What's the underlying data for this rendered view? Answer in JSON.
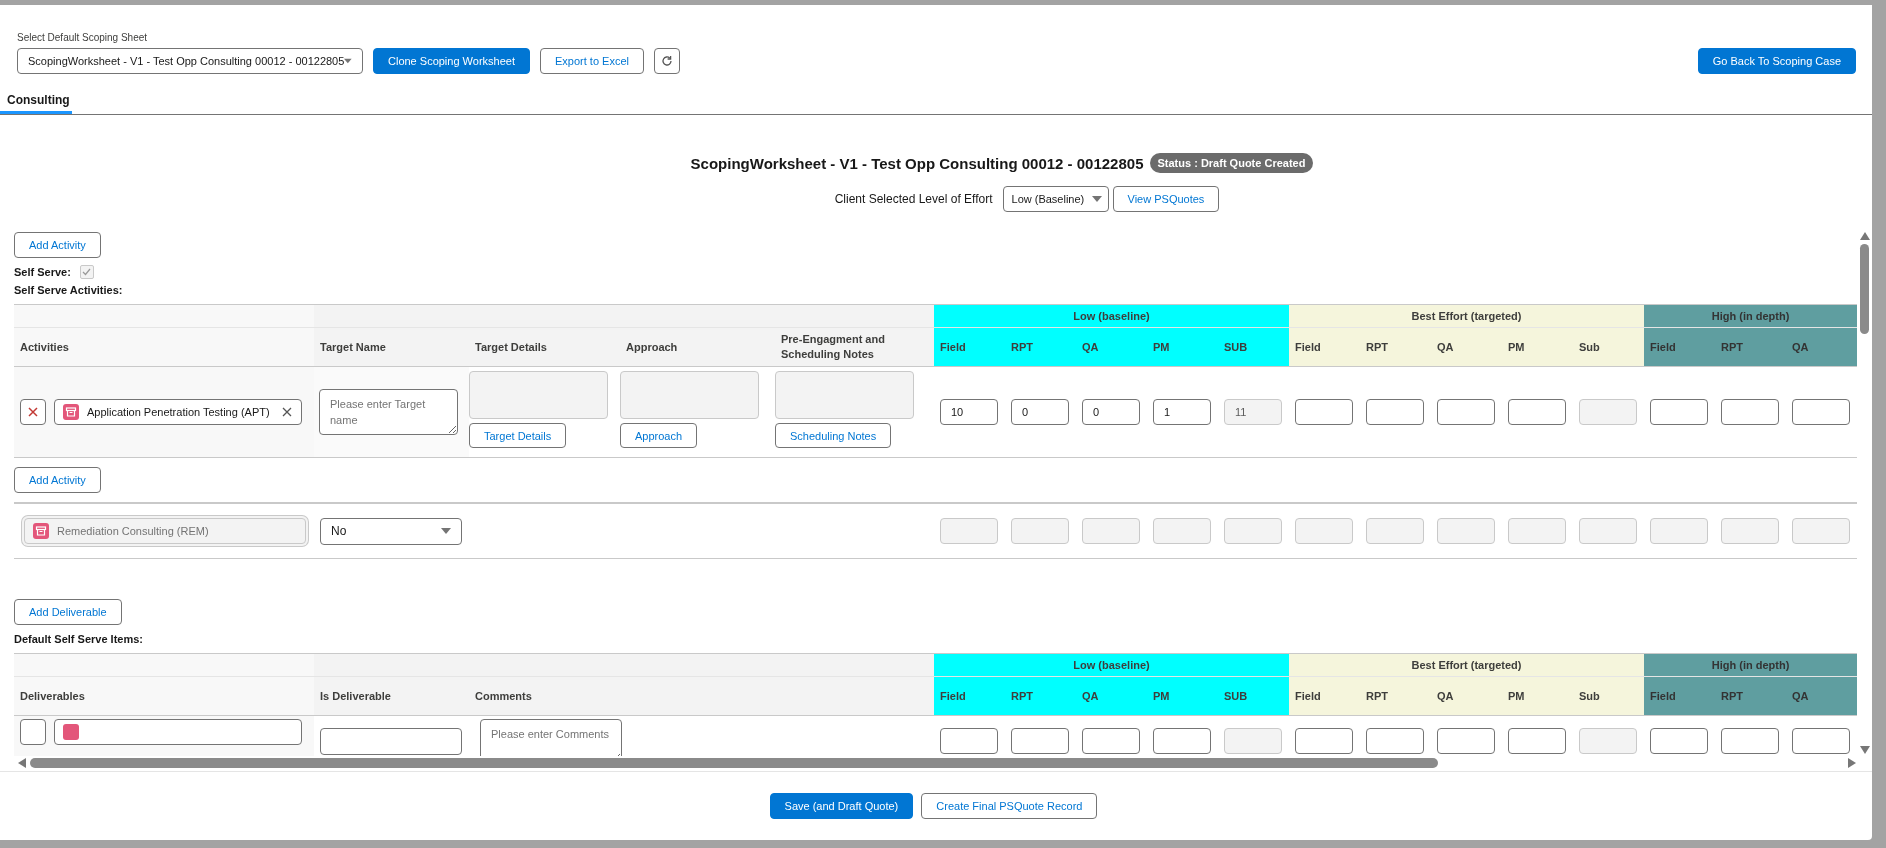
{
  "sheet_select": {
    "label": "Select Default Scoping Sheet",
    "value": "ScopingWorksheet - V1 - Test Opp Consulting 00012 - 00122805"
  },
  "toolbar": [
    {
      "kind": "brand",
      "label": "Clone Scoping Worksheet"
    },
    {
      "kind": "neutral",
      "label": "Export to Excel"
    },
    {
      "kind": "refresh"
    }
  ],
  "back_button": {
    "label": "Go Back To Scoping Case"
  },
  "tabs": [
    {
      "label": "Consulting",
      "selected": true
    }
  ],
  "worksheet": {
    "title": "ScopingWorksheet - V1 - Test Opp Consulting 00012 - 00122805",
    "status": "Status : Draft Quote Created"
  },
  "effort": {
    "label": "Client Selected Level of Effort",
    "value": "Low (Baseline)",
    "button": "View PSQuotes"
  },
  "activities": {
    "add_button": "Add Activity",
    "self_serve": {
      "label": "Self Serve:",
      "checked": true,
      "disabled": true
    },
    "heading": "Self Serve Activities:",
    "columns": [
      "Activities",
      "Target Name",
      "Target Details",
      "Approach",
      "Pre-Engagment and Scheduling Notes"
    ],
    "tiers": [
      {
        "label": "Low (baseline)",
        "color": "#00ffff",
        "columns": [
          "Field",
          "RPT",
          "QA",
          "PM",
          "SUB"
        ]
      },
      {
        "label": "Best Effort (targeted)",
        "color": "#f5f5dc",
        "columns": [
          "Field",
          "RPT",
          "QA",
          "PM",
          "Sub"
        ]
      },
      {
        "label": "High (in depth)",
        "color": "#5f9ea0",
        "columns": [
          "Field",
          "RPT",
          "QA"
        ]
      }
    ],
    "rows": [
      {
        "name": "Application Penetration Testing (APT)",
        "target_name_placeholder": "Please enter Target name",
        "buttons": [
          "Target Details",
          "Approach",
          "Scheduling Notes"
        ],
        "efforts": [
          {
            "value": "10",
            "disabled": false
          },
          {
            "value": "0",
            "disabled": false
          },
          {
            "value": "0",
            "disabled": false
          },
          {
            "value": "1",
            "disabled": false
          },
          {
            "value": "11",
            "disabled": true
          },
          {
            "disabled": false
          },
          {
            "disabled": false
          },
          {
            "disabled": false
          },
          {
            "disabled": false
          },
          {
            "disabled": true
          },
          {
            "disabled": false
          },
          {
            "disabled": false
          },
          {
            "disabled": false
          }
        ]
      }
    ],
    "add_button_bottom": "Add Activity",
    "fixed_rows": [
      {
        "name": "Remediation Consulting (REM)",
        "choice": "No",
        "efforts": [
          {
            "disabled": true
          },
          {
            "disabled": true
          },
          {
            "disabled": true
          },
          {
            "disabled": true
          },
          {
            "disabled": true
          },
          {
            "disabled": true
          },
          {
            "disabled": true
          },
          {
            "disabled": true
          },
          {
            "disabled": true
          },
          {
            "disabled": true
          },
          {
            "disabled": true
          },
          {
            "disabled": true
          },
          {
            "disabled": true
          }
        ]
      }
    ]
  },
  "deliverables": {
    "add_button": "Add Deliverable",
    "heading": "Default Self Serve Items:",
    "columns": [
      "Deliverables",
      "Is Deliverable",
      "Comments"
    ],
    "tiers": [
      {
        "label": "Low (baseline)",
        "color": "#00ffff",
        "columns": [
          "Field",
          "RPT",
          "QA",
          "PM",
          "SUB"
        ]
      },
      {
        "label": "Best Effort (targeted)",
        "color": "#f5f5dc",
        "columns": [
          "Field",
          "RPT",
          "QA",
          "PM",
          "Sub"
        ]
      },
      {
        "label": "High (in depth)",
        "color": "#5f9ea0",
        "columns": [
          "Field",
          "RPT",
          "QA"
        ]
      }
    ],
    "rows": [
      {
        "comments_placeholder": "Please enter Comments",
        "efforts": [
          {
            "disabled": false
          },
          {
            "disabled": false
          },
          {
            "disabled": false
          },
          {
            "disabled": false
          },
          {
            "disabled": true
          },
          {
            "disabled": false
          },
          {
            "disabled": false
          },
          {
            "disabled": false
          },
          {
            "disabled": false
          },
          {
            "disabled": true
          },
          {
            "disabled": false
          },
          {
            "disabled": false
          },
          {
            "disabled": false
          }
        ]
      }
    ]
  },
  "footer": [
    {
      "kind": "brand",
      "label": "Save (and Draft Quote)"
    },
    {
      "kind": "neutral",
      "label": "Create Final PSQuote Record"
    }
  ]
}
